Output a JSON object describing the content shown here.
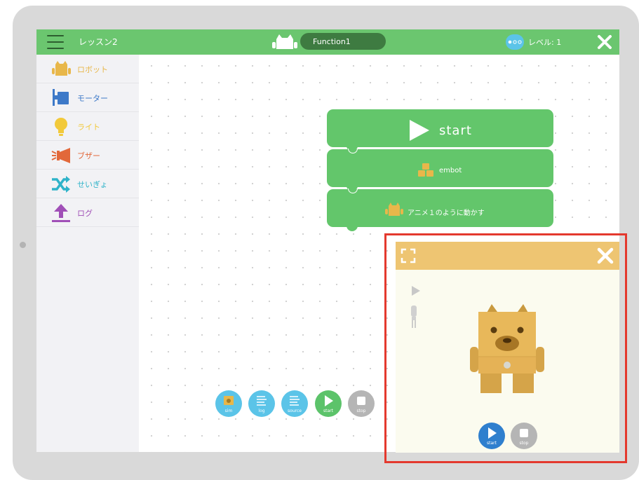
{
  "header": {
    "lesson_title": "レッスン2",
    "function_name": "Function1",
    "level_label": "レベル: 1"
  },
  "sidebar": {
    "items": [
      {
        "label": "ロボット",
        "color": "#e8b74a",
        "icon": "robot-icon"
      },
      {
        "label": "モーター",
        "color": "#3d79c8",
        "icon": "motor-icon"
      },
      {
        "label": "ライト",
        "color": "#f2c93a",
        "icon": "light-bulb-icon"
      },
      {
        "label": "ブザー",
        "color": "#e2683a",
        "icon": "buzzer-icon"
      },
      {
        "label": "せいぎょ",
        "color": "#2fb3c9",
        "icon": "shuffle-icon"
      },
      {
        "label": "ログ",
        "color": "#a04fb7",
        "icon": "upload-arrow-icon"
      }
    ]
  },
  "blocks": {
    "start_label": "start",
    "embot_label": "embot",
    "anime_label": "アニメ１のように動かす"
  },
  "toolbar": {
    "sim_label": "sim",
    "log_label": "log",
    "source_label": "source",
    "start_label": "start",
    "stop_label": "stop"
  },
  "simulator": {
    "start_label": "start",
    "stop_label": "stop"
  },
  "colors": {
    "header_green": "#6bc66f",
    "block_green": "#63c66b",
    "toolbar_blue": "#5bc4e8",
    "sim_header": "#eec572",
    "highlight_red": "#e4392e",
    "stop_gray": "#b5b5b5",
    "start_blue": "#2f7fce"
  }
}
